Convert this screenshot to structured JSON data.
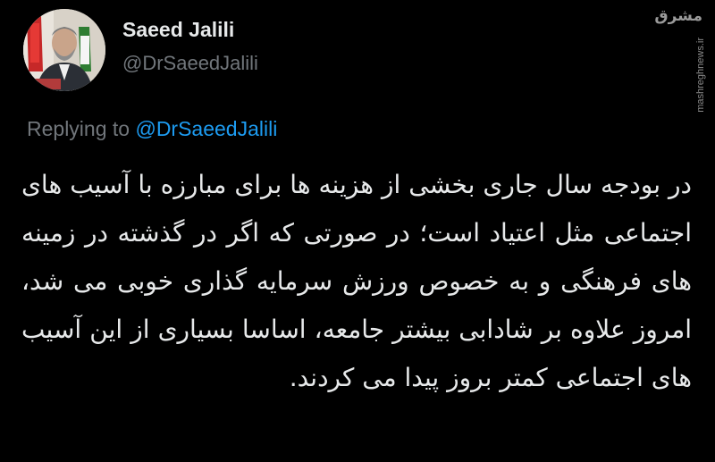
{
  "author": {
    "display_name": "Saeed Jalili",
    "handle": "@DrSaeedJalili"
  },
  "reply": {
    "prefix": "Replying to",
    "mention": "@DrSaeedJalili"
  },
  "tweet": {
    "text": "در بودجه سال جاری بخشی از هزینه ها برای مبارزه با آسیب های اجتماعی مثل اعتیاد است؛ در صورتی که اگر در گذشته در زمینه های فرهنگی و به خصوص ورزش سرمایه گذاری خوبی می شد، امروز علاوه بر شادابی بیشتر جامعه، اساسا بسیاری از این آسیب های اجتماعی کمتر بروز پیدا می کردند."
  },
  "watermark": {
    "logo": "مشرق",
    "site": "mashreghnews.ir"
  },
  "colors": {
    "background": "#000000",
    "primary_text": "#e7e9ea",
    "secondary_text": "#71767b",
    "accent": "#1d9bf0"
  },
  "icons": {
    "avatar": "profile-photo",
    "watermark": "mashregh-logo"
  }
}
